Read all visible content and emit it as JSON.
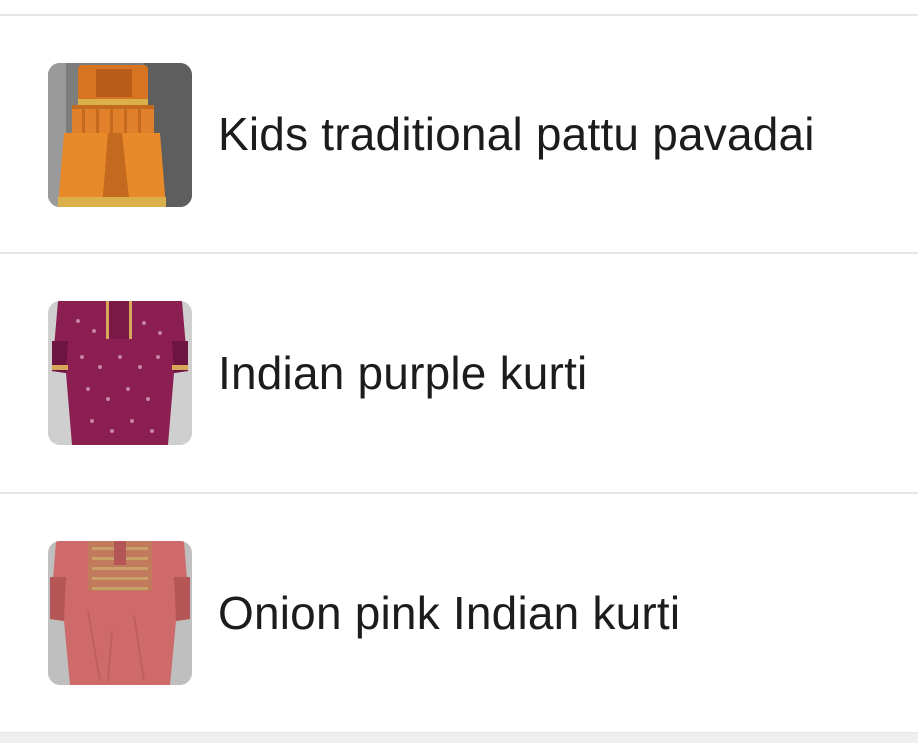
{
  "listings": [
    {
      "title": "Kids traditional pattu pavadai",
      "thumbnail": {
        "background": "#8a8a8a",
        "garment_main": "#e8892a",
        "garment_accent": "#c46a1e",
        "trim": "#d9b04a"
      }
    },
    {
      "title": "Indian purple kurti",
      "thumbnail": {
        "background": "#c9c9c9",
        "garment_main": "#8b1f52",
        "garment_accent": "#6e1440",
        "trim": "#d8a85a"
      }
    },
    {
      "title": "Onion pink Indian kurti",
      "thumbnail": {
        "background": "#bdbdbd",
        "garment_main": "#cf6a6a",
        "garment_accent": "#b45656",
        "trim": "#c9a56a"
      }
    }
  ]
}
